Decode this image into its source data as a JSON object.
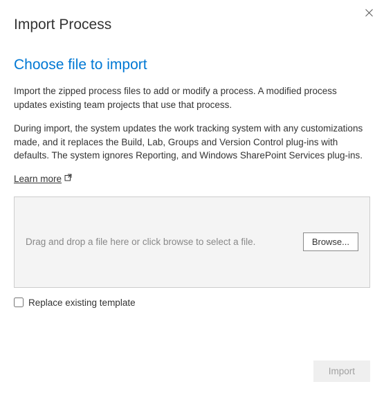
{
  "dialog": {
    "title": "Import Process"
  },
  "section": {
    "heading": "Choose file to import",
    "paragraph1": "Import the zipped process files to add or modify a process. A modified process updates existing team projects that use that process.",
    "paragraph2": "During import, the system updates the work tracking system with any customizations made, and it replaces the Build, Lab, Groups and Version Control plug-ins with defaults. The system ignores Reporting, and Windows SharePoint Services plug-ins.",
    "learn_more_label": "Learn more"
  },
  "dropzone": {
    "placeholder": "Drag and drop a file here or click browse to select a file.",
    "browse_label": "Browse..."
  },
  "options": {
    "replace_label": "Replace existing template"
  },
  "footer": {
    "import_label": "Import"
  }
}
